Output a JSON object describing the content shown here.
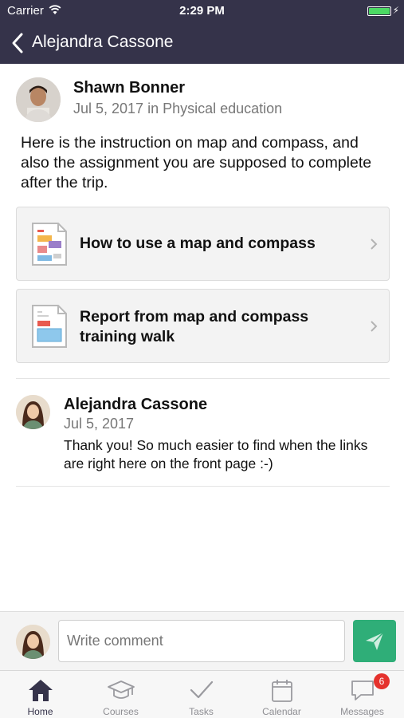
{
  "status_bar": {
    "carrier": "Carrier",
    "time": "2:29 PM",
    "battery_level": 1.0
  },
  "nav": {
    "title": "Alejandra Cassone"
  },
  "post": {
    "author": "Shawn Bonner",
    "meta": "Jul 5, 2017 in Physical education",
    "body": "Here is the instruction on map and compass, and also the assignment you are supposed to complete after the trip."
  },
  "attachments": [
    {
      "label": "How to use a map and compass"
    },
    {
      "label": "Report from map and compass training walk"
    }
  ],
  "comments": [
    {
      "author": "Alejandra Cassone",
      "date": "Jul 5, 2017",
      "body": "Thank you! So much easier to find when the links are right here on the front page :-)"
    }
  ],
  "composer": {
    "placeholder": "Write comment"
  },
  "tabs": [
    {
      "label": "Home",
      "icon": "home-icon",
      "active": true
    },
    {
      "label": "Courses",
      "icon": "graduation-cap-icon",
      "active": false
    },
    {
      "label": "Tasks",
      "icon": "checkmark-icon",
      "active": false
    },
    {
      "label": "Calendar",
      "icon": "calendar-icon",
      "active": false
    },
    {
      "label": "Messages",
      "icon": "chat-bubble-icon",
      "active": false,
      "badge": "6"
    }
  ],
  "colors": {
    "header_bg": "#35334a",
    "accent_green": "#2fae78",
    "badge_red": "#e5322d",
    "battery_green": "#4cd964"
  }
}
